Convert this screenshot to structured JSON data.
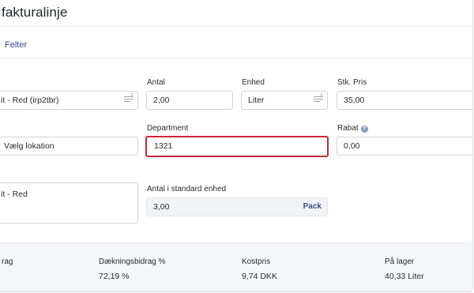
{
  "header": {
    "title": "fakturalinje",
    "fields_tab": "Felter"
  },
  "form": {
    "item": {
      "value": "it - Red (irp2tbr)"
    },
    "quantity": {
      "label": "Antal",
      "value": "2,00"
    },
    "unit": {
      "label": "Enhed",
      "value": "Liter"
    },
    "unit_price": {
      "label": "Stk. Pris",
      "value": "35,00"
    },
    "location": {
      "value": "Vælg lokation"
    },
    "department": {
      "label": "Department",
      "value": "1321"
    },
    "discount": {
      "label": "Rabat",
      "help": "?",
      "value": "0,00"
    },
    "description": {
      "value": "it - Red"
    },
    "standard_qty": {
      "label": "Antal i standard enhed",
      "value": "3,00",
      "unit_label": "Pack"
    }
  },
  "stats": [
    {
      "label": "rag",
      "value": ""
    },
    {
      "label": "Dækningsbidrag %",
      "value": "72,19 %"
    },
    {
      "label": "Kostpris",
      "value": "9,74 DKK"
    },
    {
      "label": "På lager",
      "value": "40,33 Liter"
    }
  ]
}
